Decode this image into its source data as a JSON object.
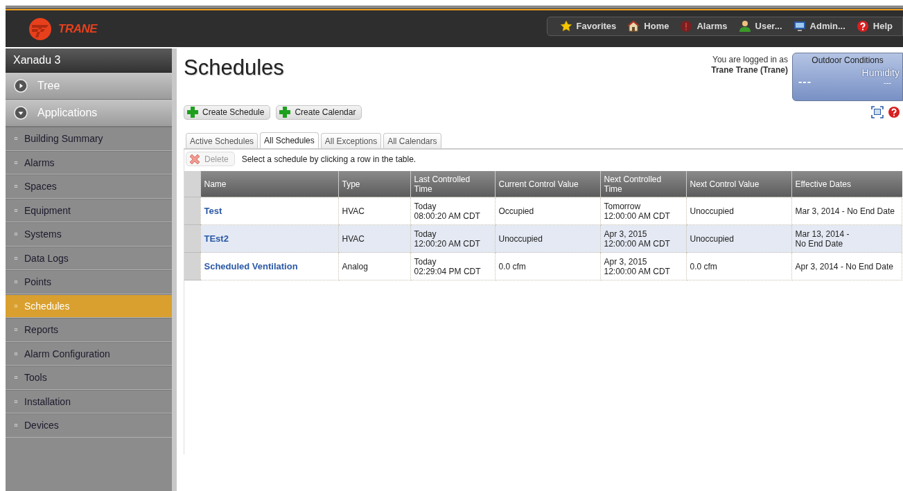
{
  "header": {
    "brand": "TRANE",
    "nav": [
      {
        "label": "Favorites",
        "kind": "star"
      },
      {
        "label": "Home",
        "kind": "home"
      },
      {
        "label": "Alarms",
        "kind": "alarm"
      },
      {
        "label": "User...",
        "kind": "user"
      },
      {
        "label": "Admin...",
        "kind": "monitor"
      },
      {
        "label": "Help",
        "kind": "help"
      }
    ]
  },
  "sidebar": {
    "title": "Xanadu 3",
    "sections": [
      {
        "label": "Tree",
        "expanded": false
      },
      {
        "label": "Applications",
        "expanded": true,
        "items": [
          {
            "label": "Building Summary",
            "selected": false
          },
          {
            "label": "Alarms",
            "selected": false
          },
          {
            "label": "Spaces",
            "selected": false
          },
          {
            "label": "Equipment",
            "selected": false
          },
          {
            "label": "Systems",
            "selected": false
          },
          {
            "label": "Data Logs",
            "selected": false
          },
          {
            "label": "Points",
            "selected": false
          },
          {
            "label": "Schedules",
            "selected": true
          },
          {
            "label": "Reports",
            "selected": false
          },
          {
            "label": "Alarm Configuration",
            "selected": false
          },
          {
            "label": "Tools",
            "selected": false
          },
          {
            "label": "Installation",
            "selected": false
          },
          {
            "label": "Devices",
            "selected": false
          }
        ]
      }
    ]
  },
  "main": {
    "title": "Schedules",
    "login": {
      "prefix": "You are logged in as",
      "user": "Trane Trane (Trane)"
    },
    "outdoor_conditions": {
      "title": "Outdoor Conditions",
      "reading": "---",
      "humidity_label": "Humidity",
      "humidity_value": "---"
    },
    "actions": [
      {
        "label": "Create Schedule"
      },
      {
        "label": "Create Calendar"
      }
    ],
    "tabs": [
      {
        "label": "Active Schedules",
        "selected": false
      },
      {
        "label": "All Schedules",
        "selected": true
      },
      {
        "label": "All Exceptions",
        "selected": false
      },
      {
        "label": "All Calendars",
        "selected": false
      }
    ],
    "delete_button": {
      "label": "Delete",
      "disabled": true
    },
    "hint": "Select a schedule by clicking a row in the table.",
    "table": {
      "columns": [
        "Name",
        "Type",
        "Last Controlled\nTime",
        "Current Control Value",
        "Next Controlled\nTime",
        "Next Control Value",
        "Effective Dates"
      ],
      "rows": [
        {
          "selected": false,
          "cells": [
            "Test",
            "HVAC",
            "Today\n08:00:20 AM CDT",
            "Occupied",
            "Tomorrow\n12:00:00 AM CDT",
            "Unoccupied",
            "Mar 3, 2014 - No End Date"
          ]
        },
        {
          "selected": true,
          "cells": [
            "TEst2",
            "HVAC",
            "Today\n12:00:20 AM CDT",
            "Unoccupied",
            "Apr 3, 2015\n12:00:00 AM CDT",
            "Unoccupied",
            "Mar 13, 2014 -\nNo End Date"
          ]
        },
        {
          "selected": false,
          "cells": [
            "Scheduled Ventilation",
            "Analog",
            "Today\n02:29:04 PM CDT",
            "0.0 cfm",
            "Apr 3, 2015\n12:00:00 AM CDT",
            "0.0 cfm",
            "Apr 3, 2014 - No End Date"
          ]
        }
      ]
    }
  }
}
